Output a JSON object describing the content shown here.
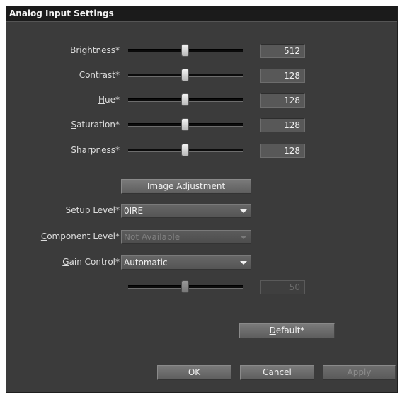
{
  "window": {
    "title": "Analog Input Settings"
  },
  "sliders": [
    {
      "label_pre": "",
      "label_key": "B",
      "label_post": "rightness*",
      "value": "512"
    },
    {
      "label_pre": "",
      "label_key": "C",
      "label_post": "ontrast*",
      "value": "128"
    },
    {
      "label_pre": "",
      "label_key": "H",
      "label_post": "ue*",
      "value": "128"
    },
    {
      "label_pre": "",
      "label_key": "S",
      "label_post": "aturation*",
      "value": "128"
    },
    {
      "label_pre": "Sh",
      "label_key": "a",
      "label_post": "rpness*",
      "value": "128"
    }
  ],
  "image_adjustment": {
    "pre": "",
    "key": "I",
    "post": "mage Adjustment"
  },
  "setup_level": {
    "label_pre": "S",
    "label_key": "e",
    "label_post": "tup Level*",
    "value": "0IRE"
  },
  "component_level": {
    "label_pre": "",
    "label_key": "C",
    "label_post": "omponent Level*",
    "value": "Not Available"
  },
  "gain_control": {
    "label_pre": "",
    "label_key": "G",
    "label_post": "ain Control*",
    "value": "Automatic",
    "slider_value": "50"
  },
  "default_button": {
    "pre": "",
    "key": "D",
    "post": "efault*"
  },
  "buttons": {
    "ok": "OK",
    "cancel": "Cancel",
    "apply": "Apply"
  }
}
